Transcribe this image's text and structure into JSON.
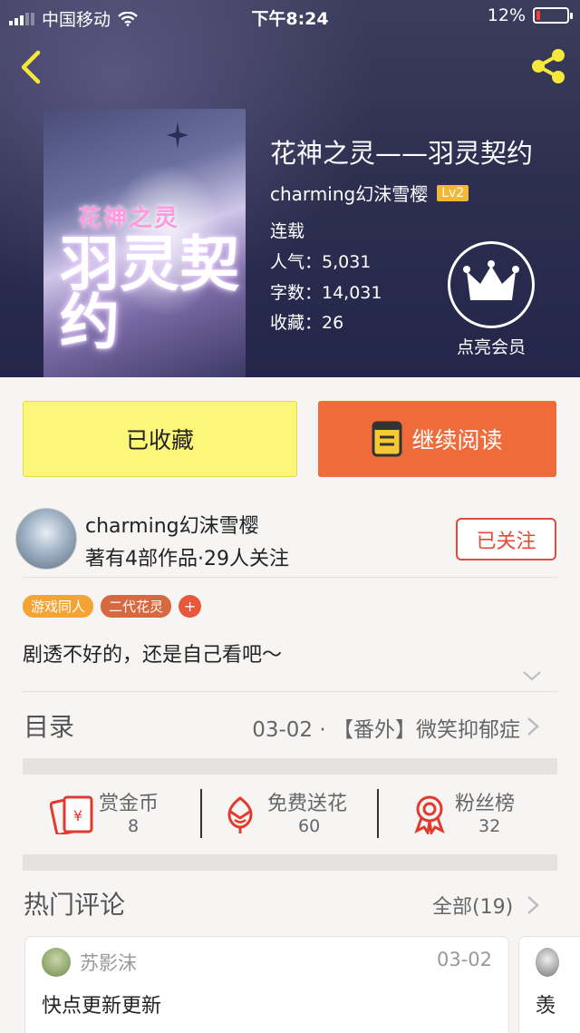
{
  "status_bar": {
    "carrier": "中国移动",
    "time": "下午8:24",
    "battery": "12%",
    "battery_level": 0.12
  },
  "book": {
    "cover_title_small": "花神之灵",
    "cover_title_large": "羽灵契约",
    "title": "花神之灵——羽灵契约",
    "author": "charming幻沫雪樱",
    "author_level": "Lv2",
    "status": "连载",
    "popularity": "人气：5,031",
    "word_count": "字数：14,031",
    "favorites": "收藏：26",
    "vip_label": "点亮会员"
  },
  "actions": {
    "favorite_label": "已收藏",
    "read_label": "继续阅读"
  },
  "author_info": {
    "name": "charming幻沫雪樱",
    "summary": "著有4部作品·29人关注",
    "follow_label": "已关注"
  },
  "tags": [
    "游戏同人",
    "二代花灵"
  ],
  "tag_add": "+",
  "description": "剧透不好的，还是自己看吧～",
  "toc": {
    "label": "目录",
    "latest": "03-02 · 【番外】微笑抑郁症"
  },
  "stats": [
    {
      "label": "赏金币",
      "value": "8",
      "icon": "red-envelope-icon"
    },
    {
      "label": "免费送花",
      "value": "60",
      "icon": "flower-icon"
    },
    {
      "label": "粉丝榜",
      "value": "32",
      "icon": "ribbon-medal-icon"
    }
  ],
  "comments": {
    "header": "热门评论",
    "all_label": "全部(19)",
    "items": [
      {
        "user": "苏影沫",
        "date": "03-02",
        "text": "快点更新更新"
      },
      {
        "user": "",
        "date": "",
        "text": "羡"
      }
    ]
  },
  "colors": {
    "accent_orange": "#ef6b3a",
    "favorite_yellow": "#fcf779",
    "follow_red": "#e24a3c",
    "level_badge": "#f2b734"
  }
}
